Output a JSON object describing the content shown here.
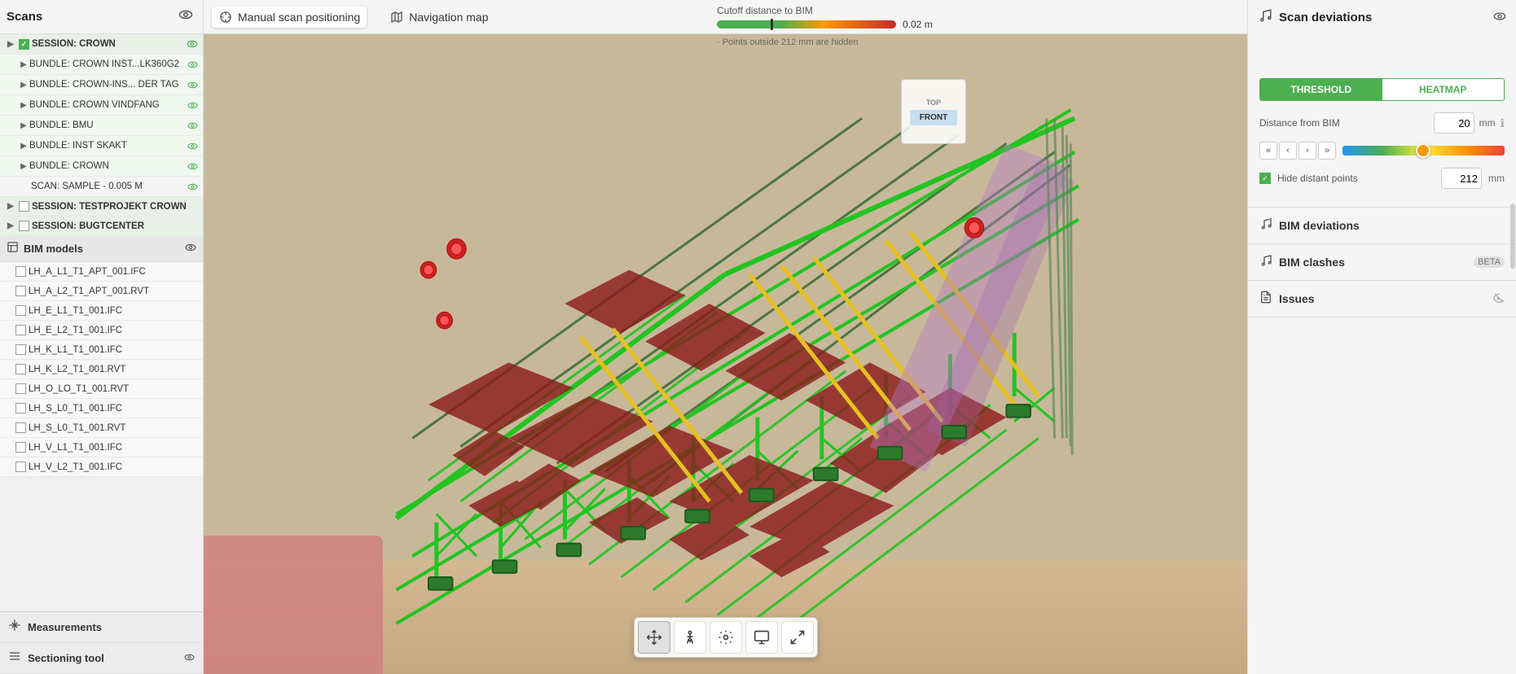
{
  "toolbar": {
    "scans_label": "Scans",
    "manual_scan_label": "Manual scan positioning",
    "nav_map_label": "Navigation map",
    "cutoff_label": "Cutoff distance to BIM",
    "cutoff_value": "0.02 m",
    "hidden_msg": "· Points outside 212 mm are hidden",
    "scan_dev_label": "Scan deviations",
    "threshold_tab": "THRESHOLD",
    "heatmap_tab": "HEATMAP",
    "distance_bim_label": "Distance from BIM",
    "distance_bim_value": "20",
    "distance_bim_unit": "mm",
    "hide_distant_label": "Hide distant points",
    "hide_distant_value": "212",
    "hide_distant_unit": "mm"
  },
  "sidebar": {
    "sessions": [
      {
        "label": "SESSION: CROWN",
        "expanded": true,
        "bundles": [
          {
            "label": "BUNDLE: CROWN INST...LK360G2",
            "visible": true
          },
          {
            "label": "BUNDLE: CROWN-INS... DER TAG",
            "visible": true
          },
          {
            "label": "BUNDLE: CROWN VINDFANG",
            "visible": true
          },
          {
            "label": "BUNDLE: BMU",
            "visible": true
          },
          {
            "label": "BUNDLE: INST SKAKT",
            "visible": true
          },
          {
            "label": "BUNDLE: CROWN",
            "visible": true,
            "scans": [
              {
                "label": "SCAN: SAMPLE - 0.005 M",
                "visible": true
              }
            ]
          }
        ]
      },
      {
        "label": "SESSION: TESTPROJEKT CROWN",
        "expanded": false
      },
      {
        "label": "SESSION: BUGTCENTER",
        "expanded": false
      }
    ],
    "bim_section_label": "BIM models",
    "bim_files": [
      "LH_A_L1_T1_APT_001.IFC",
      "LH_A_L2_T1_APT_001.RVT",
      "LH_E_L1_T1_001.IFC",
      "LH_E_L2_T1_001.IFC",
      "LH_K_L1_T1_001.IFC",
      "LH_K_L2_T1_001.RVT",
      "LH_O_LO_T1_001.RVT",
      "LH_S_L0_T1_001.IFC",
      "LH_S_L0_T1_001.RVT",
      "LH_V_L1_T1_001.IFC",
      "LH_V_L2_T1_001.IFC"
    ],
    "measurements_label": "Measurements",
    "sectioning_label": "Sectioning tool"
  },
  "right_panel": {
    "bim_deviations_label": "BIM deviations",
    "bim_clashes_label": "BIM clashes",
    "bim_clashes_badge": "BETA",
    "issues_label": "Issues"
  },
  "viewport_toolbar": {
    "buttons": [
      "move",
      "person",
      "settings",
      "screen",
      "fullscreen"
    ]
  }
}
